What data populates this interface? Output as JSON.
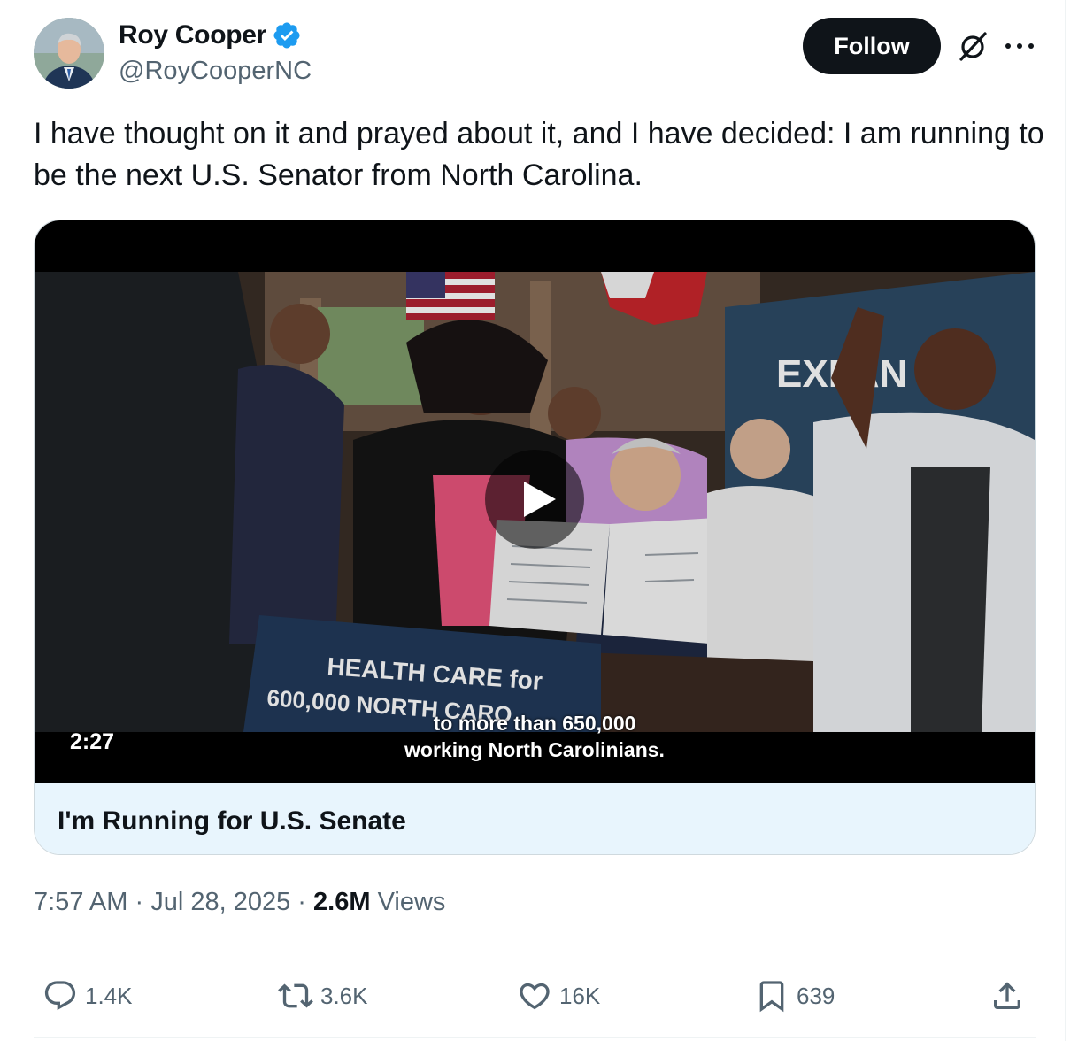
{
  "author": {
    "name": "Roy Cooper",
    "handle": "@RoyCooperNC",
    "verified": true
  },
  "header": {
    "follow_label": "Follow"
  },
  "tweet": {
    "text": "I have thought on it and prayed about it, and I have decided: I am running to be the next U.S. Senator from North Carolina."
  },
  "media": {
    "duration": "2:27",
    "caption_line1": "to more than 650,000",
    "caption_line2": "working North Carolinians.",
    "sign_line1": "HEALTH CARE for",
    "sign_line2": "600,000 NORTH CARO",
    "banner_text": "EXPAN",
    "title": "I'm Running for U.S. Senate"
  },
  "meta": {
    "time": "7:57 AM",
    "date": "Jul 28, 2025",
    "views_count": "2.6M",
    "views_label": "Views",
    "separator": "·"
  },
  "actions": {
    "replies": "1.4K",
    "reposts": "3.6K",
    "likes": "16K",
    "bookmarks": "639"
  },
  "colors": {
    "verified": "#1d9bf0",
    "follow_bg": "#0f1419",
    "secondary_text": "#536471",
    "title_bar": "#e8f5fd"
  },
  "icons": [
    "verified-badge-icon",
    "grok-icon",
    "more-icon",
    "play-icon",
    "reply-icon",
    "repost-icon",
    "like-icon",
    "bookmark-icon",
    "share-icon"
  ]
}
